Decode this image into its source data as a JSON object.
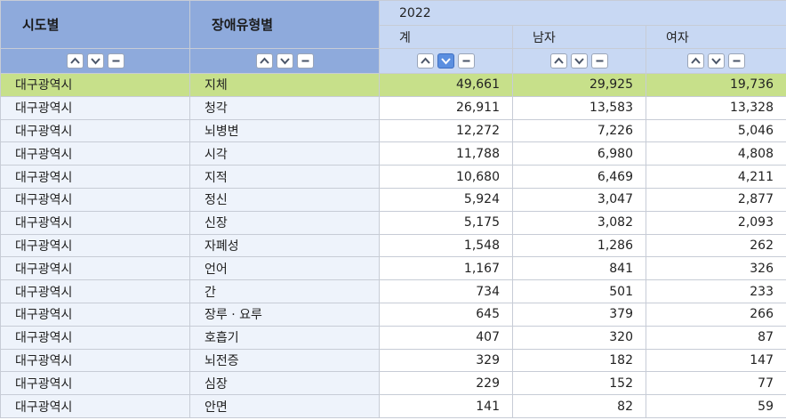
{
  "headers": {
    "dim1": "시도별",
    "dim2": "장애유형별",
    "year": "2022",
    "measures": [
      "계",
      "남자",
      "여자"
    ]
  },
  "controls": {
    "icons": [
      "chevron-up-icon",
      "chevron-down-icon",
      "minus-icon"
    ],
    "active_sort_column": "계",
    "active_sort_direction": "descending",
    "active_color": "#5b8fe0"
  },
  "colors": {
    "highlight_row": "#c7e08a",
    "dim_header": "#8eaadc",
    "measure_header": "#c8d8f3"
  },
  "rows": [
    {
      "region": "대구광역시",
      "type": "지체",
      "total": "49,661",
      "male": "29,925",
      "female": "19,736",
      "highlight": true
    },
    {
      "region": "대구광역시",
      "type": "청각",
      "total": "26,911",
      "male": "13,583",
      "female": "13,328"
    },
    {
      "region": "대구광역시",
      "type": "뇌병변",
      "total": "12,272",
      "male": "7,226",
      "female": "5,046"
    },
    {
      "region": "대구광역시",
      "type": "시각",
      "total": "11,788",
      "male": "6,980",
      "female": "4,808"
    },
    {
      "region": "대구광역시",
      "type": "지적",
      "total": "10,680",
      "male": "6,469",
      "female": "4,211"
    },
    {
      "region": "대구광역시",
      "type": "정신",
      "total": "5,924",
      "male": "3,047",
      "female": "2,877"
    },
    {
      "region": "대구광역시",
      "type": "신장",
      "total": "5,175",
      "male": "3,082",
      "female": "2,093"
    },
    {
      "region": "대구광역시",
      "type": "자폐성",
      "total": "1,548",
      "male": "1,286",
      "female": "262"
    },
    {
      "region": "대구광역시",
      "type": "언어",
      "total": "1,167",
      "male": "841",
      "female": "326"
    },
    {
      "region": "대구광역시",
      "type": "간",
      "total": "734",
      "male": "501",
      "female": "233"
    },
    {
      "region": "대구광역시",
      "type": "장루 · 요루",
      "total": "645",
      "male": "379",
      "female": "266"
    },
    {
      "region": "대구광역시",
      "type": "호흡기",
      "total": "407",
      "male": "320",
      "female": "87"
    },
    {
      "region": "대구광역시",
      "type": "뇌전증",
      "total": "329",
      "male": "182",
      "female": "147"
    },
    {
      "region": "대구광역시",
      "type": "심장",
      "total": "229",
      "male": "152",
      "female": "77"
    },
    {
      "region": "대구광역시",
      "type": "안면",
      "total": "141",
      "male": "82",
      "female": "59"
    }
  ]
}
